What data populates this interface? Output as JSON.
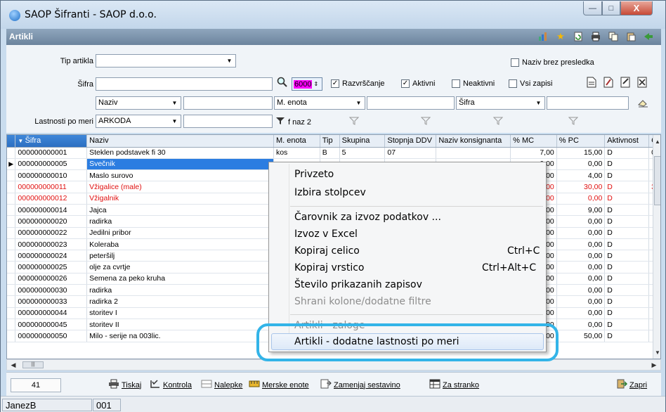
{
  "window": {
    "title": "SAOP Šifranti - SAOP d.o.o.",
    "subheader": "Artikli",
    "min_label": "—",
    "max_label": "□",
    "close_label": "X"
  },
  "filters": {
    "tip_artikla_label": "Tip artikla",
    "tip_artikla_value": "",
    "naziv_brez_presledka_label": "Naziv brez presledka",
    "sifra_label": "Šifra",
    "sifra_value": "",
    "row_count_value": "6000",
    "razvrscanje_label": "Razvrščanje",
    "aktivni_label": "Aktivni",
    "neaktivni_label": "Neaktivni",
    "vsi_zapisi_label": "Vsi zapisi",
    "naziv_select": "Naziv",
    "m_enota_select": "M. enota",
    "sifra_select": "Šifra",
    "lastnosti_label": "Lastnosti po meri",
    "lastnosti_value": "ARKODA",
    "fnaz_label": "f naz 2"
  },
  "table": {
    "columns": [
      "Šifra",
      "Naziv",
      "M. enota",
      "Tip",
      "Skupina",
      "Stopnja DDV",
      "Naziv konsignanta",
      "% MC",
      "% PC",
      "Aktivnost",
      "Č"
    ],
    "rows": [
      {
        "sifra": "000000000001",
        "naziv": "Steklen podstavek fi 30",
        "enota": "kos",
        "tip": "B",
        "skupina": "5",
        "ddv": "07",
        "konsig": "",
        "mc": "7,00",
        "pc": "15,00",
        "akt": "D",
        "c": "0:",
        "red": false,
        "sel": false
      },
      {
        "sifra": "000000000005",
        "naziv": "Svečnik",
        "enota": "",
        "tip": "",
        "skupina": "",
        "ddv": "",
        "konsig": "",
        "mc": "0,00",
        "pc": "0,00",
        "akt": "D",
        "c": "",
        "red": false,
        "sel": true
      },
      {
        "sifra": "000000000010",
        "naziv": "Maslo surovo",
        "enota": "",
        "tip": "",
        "skupina": "",
        "ddv": "",
        "konsig": "",
        "mc": "0,00",
        "pc": "4,00",
        "akt": "D",
        "c": "",
        "red": false,
        "sel": false
      },
      {
        "sifra": "000000000011",
        "naziv": "Vžigalice (male)",
        "enota": "",
        "tip": "",
        "skupina": "",
        "ddv": "",
        "konsig": "",
        "mc": "0,00",
        "pc": "30,00",
        "akt": "D",
        "c": "3!",
        "red": true,
        "sel": false
      },
      {
        "sifra": "000000000012",
        "naziv": "Vžigalnik",
        "enota": "",
        "tip": "",
        "skupina": "",
        "ddv": "",
        "konsig": "",
        "mc": "0,00",
        "pc": "0,00",
        "akt": "D",
        "c": "",
        "red": true,
        "sel": false
      },
      {
        "sifra": "000000000014",
        "naziv": "Jajca",
        "enota": "",
        "tip": "",
        "skupina": "",
        "ddv": "",
        "konsig": "",
        "mc": "0,00",
        "pc": "9,00",
        "akt": "D",
        "c": "",
        "red": false,
        "sel": false
      },
      {
        "sifra": "000000000020",
        "naziv": "radirka",
        "enota": "",
        "tip": "",
        "skupina": "",
        "ddv": "",
        "konsig": "",
        "mc": "0,00",
        "pc": "0,00",
        "akt": "D",
        "c": "",
        "red": false,
        "sel": false
      },
      {
        "sifra": "000000000022",
        "naziv": "Jedilni pribor",
        "enota": "",
        "tip": "",
        "skupina": "",
        "ddv": "",
        "konsig": "",
        "mc": "0,00",
        "pc": "0,00",
        "akt": "D",
        "c": "",
        "red": false,
        "sel": false
      },
      {
        "sifra": "000000000023",
        "naziv": "Koleraba",
        "enota": "",
        "tip": "",
        "skupina": "",
        "ddv": "",
        "konsig": "",
        "mc": "0,00",
        "pc": "0,00",
        "akt": "D",
        "c": "",
        "red": false,
        "sel": false
      },
      {
        "sifra": "000000000024",
        "naziv": "peteršilj",
        "enota": "",
        "tip": "",
        "skupina": "",
        "ddv": "",
        "konsig": "",
        "mc": "0,00",
        "pc": "0,00",
        "akt": "D",
        "c": "",
        "red": false,
        "sel": false
      },
      {
        "sifra": "000000000025",
        "naziv": "olje za cvrtje",
        "enota": "",
        "tip": "",
        "skupina": "",
        "ddv": "",
        "konsig": "",
        "mc": "0,00",
        "pc": "0,00",
        "akt": "D",
        "c": "",
        "red": false,
        "sel": false
      },
      {
        "sifra": "000000000026",
        "naziv": "Semena za peko kruha",
        "enota": "",
        "tip": "",
        "skupina": "",
        "ddv": "",
        "konsig": "",
        "mc": "0,00",
        "pc": "0,00",
        "akt": "D",
        "c": "",
        "red": false,
        "sel": false
      },
      {
        "sifra": "000000000030",
        "naziv": "radirka",
        "enota": "",
        "tip": "",
        "skupina": "",
        "ddv": "",
        "konsig": "",
        "mc": "0,00",
        "pc": "0,00",
        "akt": "D",
        "c": "",
        "red": false,
        "sel": false
      },
      {
        "sifra": "000000000033",
        "naziv": "radirka  2",
        "enota": "",
        "tip": "",
        "skupina": "",
        "ddv": "",
        "konsig": "",
        "mc": "0,00",
        "pc": "0,00",
        "akt": "D",
        "c": "",
        "red": false,
        "sel": false
      },
      {
        "sifra": "000000000044",
        "naziv": "storitev I",
        "enota": "",
        "tip": "",
        "skupina": "",
        "ddv": "",
        "konsig": "",
        "mc": "0,00",
        "pc": "0,00",
        "akt": "D",
        "c": "",
        "red": false,
        "sel": false
      },
      {
        "sifra": "000000000045",
        "naziv": "storitev II",
        "enota": "",
        "tip": "",
        "skupina": "",
        "ddv": "",
        "konsig": "",
        "mc": "0,00",
        "pc": "0,00",
        "akt": "D",
        "c": "",
        "red": false,
        "sel": false
      },
      {
        "sifra": "000000000050",
        "naziv": "Milo - serije na 003lic.",
        "enota": "",
        "tip": "",
        "skupina": "",
        "ddv": "",
        "konsig": "",
        "mc": "0,00",
        "pc": "50,00",
        "akt": "D",
        "c": "",
        "red": false,
        "sel": false
      }
    ]
  },
  "context_menu": {
    "items": [
      {
        "label": "Privzeto",
        "shortcut": "",
        "disabled": false
      },
      {
        "label": "Izbira stolpcev",
        "shortcut": "",
        "disabled": false
      },
      {
        "label": "Čarovnik za izvoz podatkov ...",
        "shortcut": "",
        "disabled": false
      },
      {
        "label": "Izvoz v Excel",
        "shortcut": "",
        "disabled": false
      },
      {
        "label": "Kopiraj celico",
        "shortcut": "Ctrl+C",
        "disabled": false
      },
      {
        "label": "Kopiraj vrstico",
        "shortcut": "Ctrl+Alt+C",
        "disabled": false
      },
      {
        "label": "Število prikazanih zapisov",
        "shortcut": "",
        "disabled": false
      },
      {
        "label": "Shrani kolone/dodatne filtre",
        "shortcut": "",
        "disabled": true
      },
      {
        "label": "Artikli - zaloge",
        "shortcut": "",
        "disabled": true
      },
      {
        "label": "Artikli - dodatne lastnosti po meri",
        "shortcut": "",
        "disabled": false
      }
    ]
  },
  "bottombar": {
    "count": "41",
    "tiskaj": "Tiskaj",
    "kontrola": "Kontrola",
    "nalepke": "Nalepke",
    "merske_enote": "Merske enote",
    "zamenjaj": "Zamenjaj sestavino",
    "za_stranko": "Za stranko",
    "zapri": "Zapri"
  },
  "statusbar": {
    "user": "JanezB",
    "code": "001"
  }
}
